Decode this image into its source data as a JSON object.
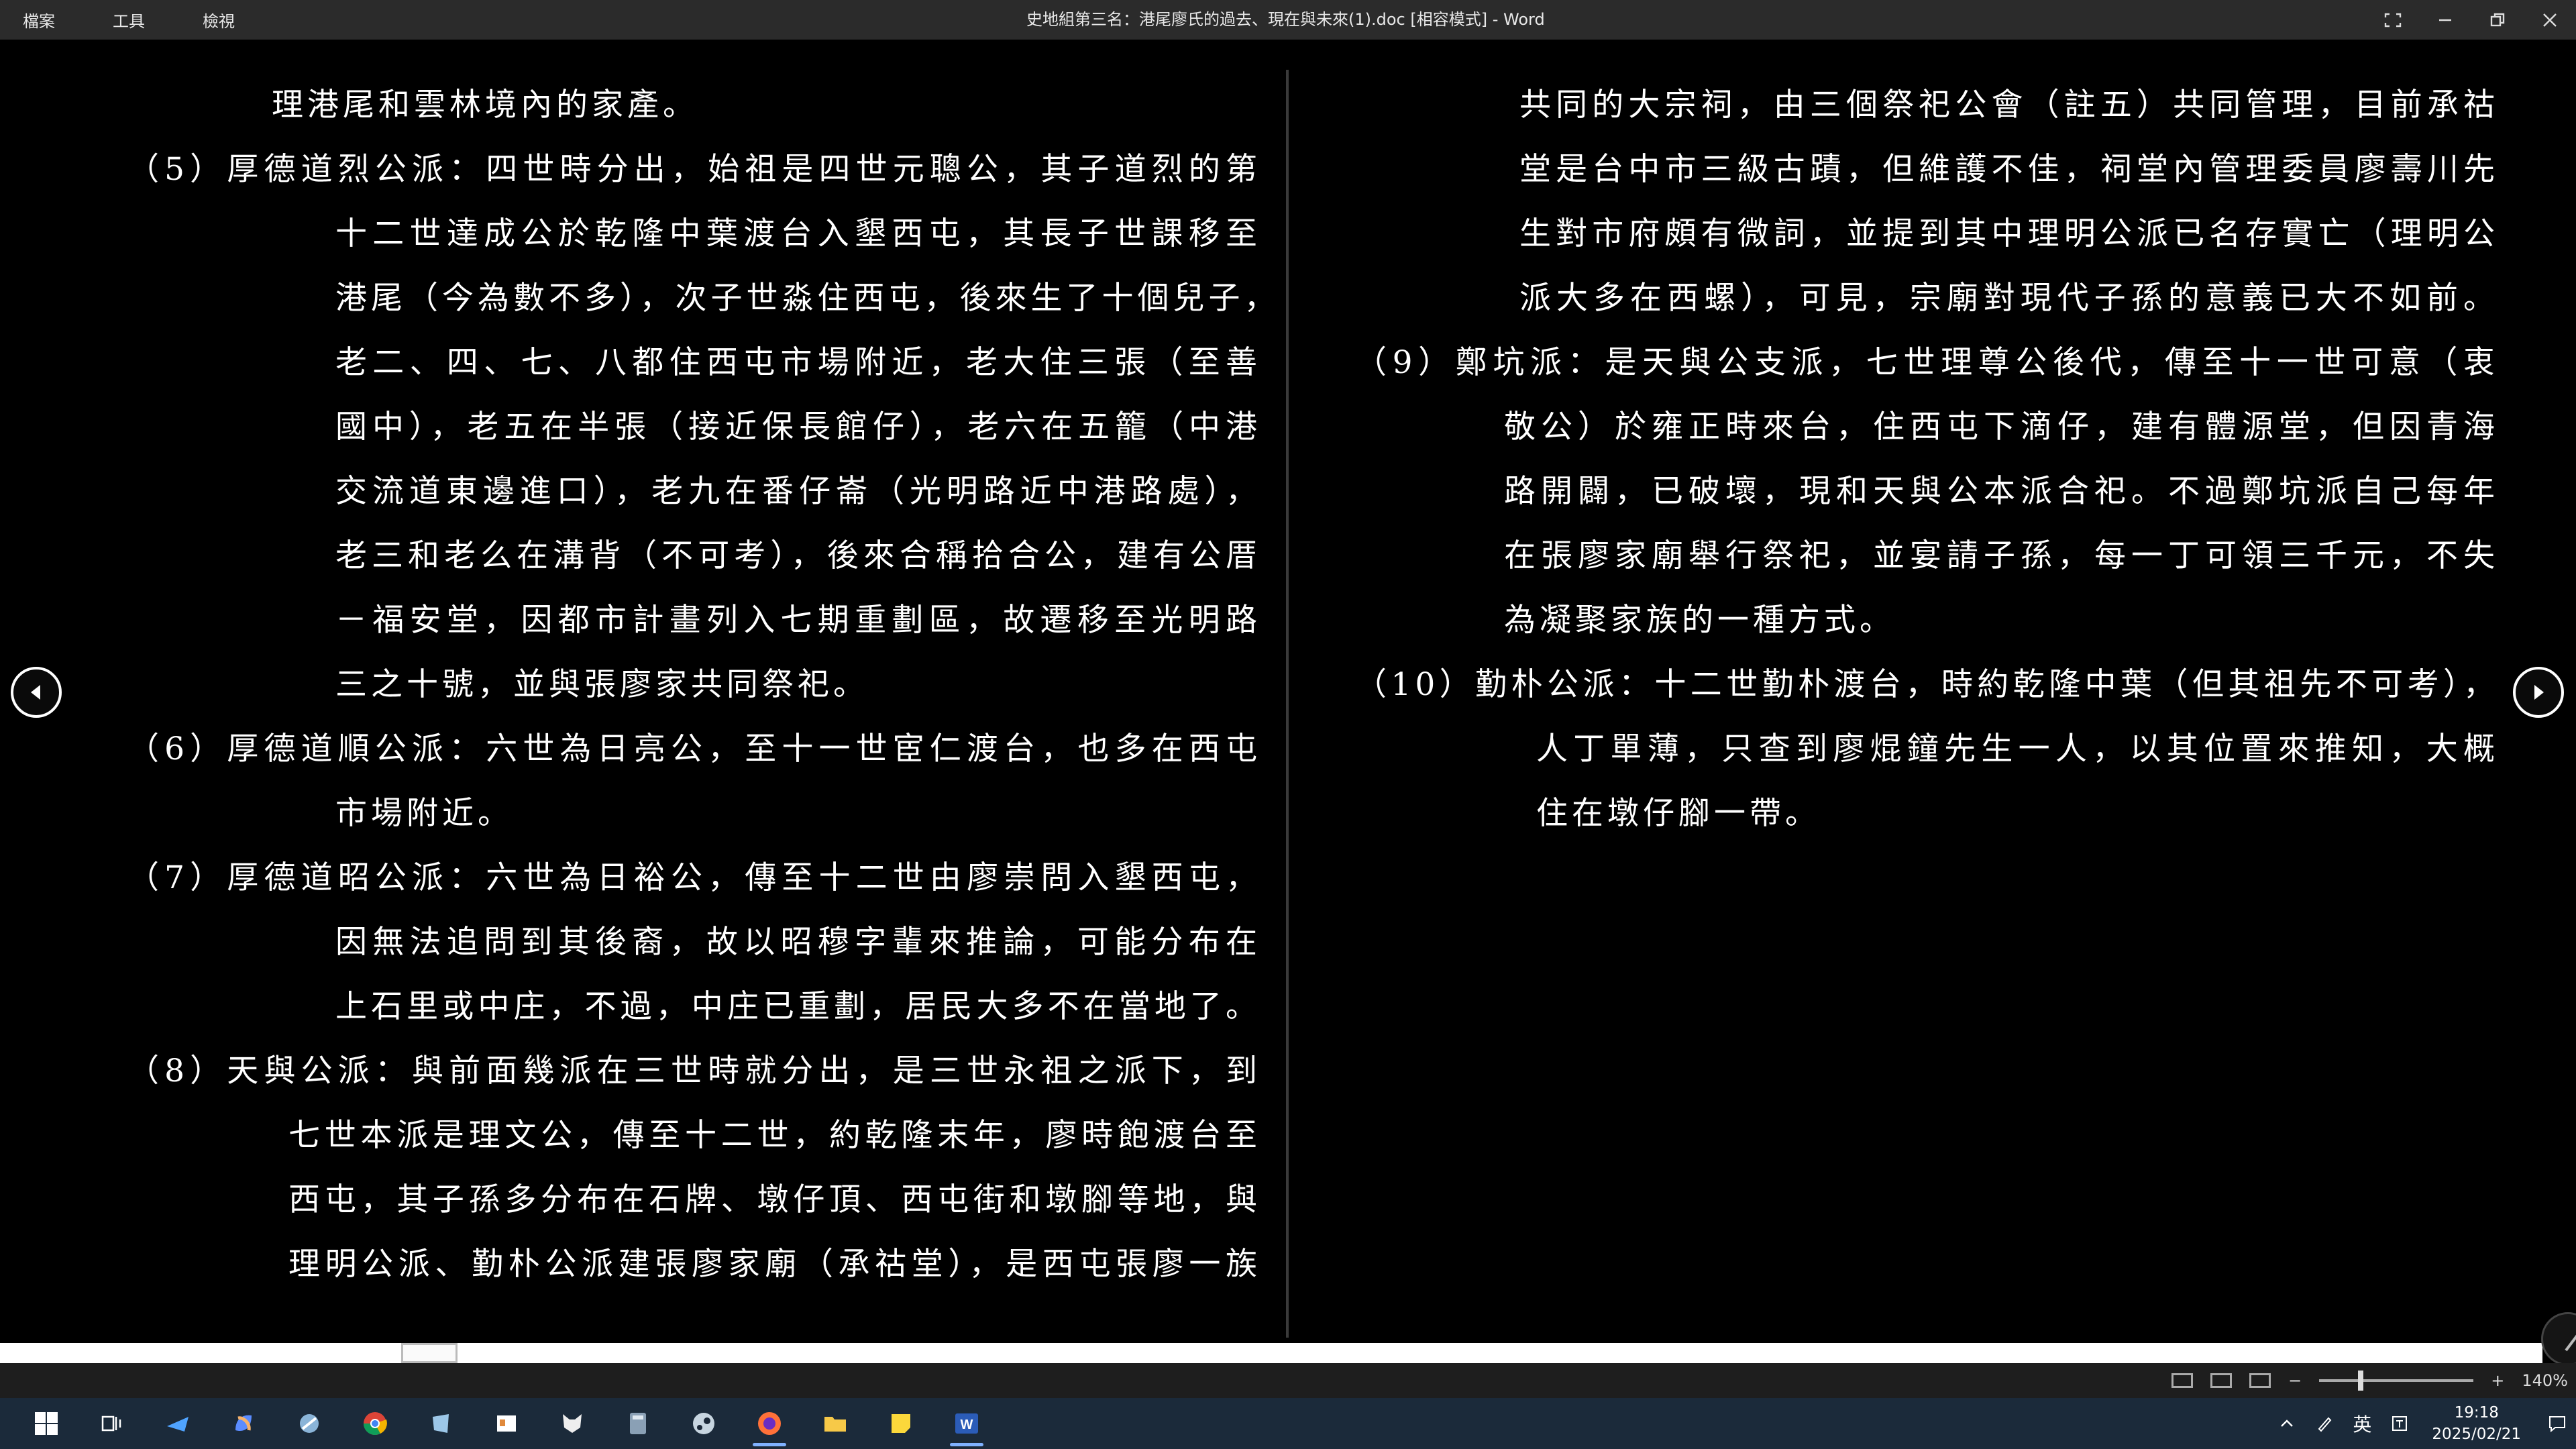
{
  "titlebar": {
    "menu": [
      "檔案",
      "工具",
      "檢視"
    ],
    "title": "史地組第三名：港尾廖氏的過去、現在與未來(1).doc [相容模式]  -  Word"
  },
  "document": {
    "left_lines": [
      "理港尾和雲林境內的家產。",
      "（5）厚德道烈公派：四世時分出，始祖是四世元聰公，其子道烈的第",
      "十二世達成公於乾隆中葉渡台入墾西屯，其長子世課移至",
      "港尾（今為數不多），次子世淼住西屯，後來生了十個兒子，",
      "老二、四、七、八都住西屯市場附近，老大住三張（至善",
      "國中），老五在半張（接近保長館仔），老六在五籠（中港",
      "交流道東邊進口），老九在番仔崙（光明路近中港路處），",
      "老三和老么在溝背（不可考），後來合稱拾合公，建有公厝",
      "－福安堂，因都市計畫列入七期重劃區，故遷移至光明路",
      "三之十號，並與張廖家共同祭祀。",
      "（6）厚德道順公派：六世為日亮公，至十一世宦仁渡台，也多在西屯",
      "市場附近。",
      "（7）厚德道昭公派：六世為日裕公，傳至十二世由廖崇問入墾西屯，",
      "因無法追問到其後裔，故以昭穆字輩來推論，可能分布在",
      "上石里或中庄，不過，中庄已重劃，居民大多不在當地了。",
      "（8）天與公派：與前面幾派在三世時就分出，是三世永祖之派下，到",
      "七世本派是理文公，傳至十二世，約乾隆末年，廖時飽渡台至",
      "西屯，其子孫多分布在石牌、墩仔頂、西屯街和墩腳等地，與",
      "理明公派、勤朴公派建張廖家廟（承祜堂），是西屯張廖一族"
    ],
    "right_lines": [
      "共同的大宗祠，由三個祭祀公會（註五）共同管理，目前承祜",
      "堂是台中市三級古蹟，但維護不佳，祠堂內管理委員廖壽川先",
      "生對市府頗有微詞，並提到其中理明公派已名存實亡（理明公",
      "派大多在西螺），可見，宗廟對現代子孫的意義已大不如前。",
      "（9）鄭坑派：是天與公支派，七世理尊公後代，傳至十一世可意（衷",
      "敬公）於雍正時來台，住西屯下滴仔，建有體源堂，但因青海",
      "路開闢，已破壞，現和天與公本派合祀。不過鄭坑派自己每年",
      "在張廖家廟舉行祭祀，並宴請子孫，每一丁可領三千元，不失",
      "為凝聚家族的一種方式。",
      "（10）勤朴公派：十二世勤朴渡台，時約乾隆中葉（但其祖先不可考），",
      "人丁單薄，只查到廖焜鐘先生一人，以其位置來推知，大概",
      "住在墩仔腳一帶。"
    ]
  },
  "statusbar": {
    "zoom": "140%"
  },
  "taskbar": {
    "ime": "英",
    "time": "19:18",
    "date": "2025/02/21"
  }
}
